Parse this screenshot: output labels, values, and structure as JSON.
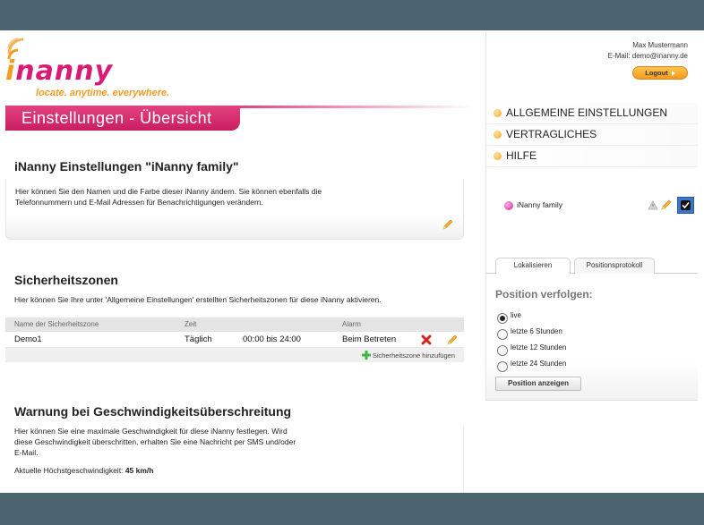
{
  "brand": {
    "name": "nanny",
    "initial": "i",
    "tagline": "locate. anytime. everywhere."
  },
  "header": {
    "title": "Einstellungen - Übersicht"
  },
  "settings": {
    "title": "iNanny Einstellungen \"iNanny family\"",
    "desc_line1": "Hier können Sie den Namen und die Farbe dieser iNanny ändern. Sie können ebenfalls die",
    "desc_line2": "Telefonnummern und E-Mail Adressen für Benachrichtigungen verändern."
  },
  "zones": {
    "title": "Sicherheitszonen",
    "desc": "Hier können Sie Ihre unter 'Allgemeine Einstellungen' erstellten Sicherheitszonen für diese iNanny aktivieren.",
    "columns": [
      "Name der Sicherheitszone",
      "Zeit",
      "Alarm"
    ],
    "rows": [
      {
        "name": "Demo1",
        "day": "Täglich",
        "time": "00:00 bis 24:00",
        "alarm": "Beim Betreten"
      }
    ],
    "add_label": "Sicherheitszone hinzufügen"
  },
  "speed": {
    "title": "Warnung bei Geschwindigkeitsüberschreitung",
    "desc_line1": "Hier können Sie eine maximale Geschwindigkeit für diese iNanny festlegen. Wird",
    "desc_line2": "diese Geschwindigkeit überschritten, erhalten Sie eine Nachricht per SMS und/oder",
    "desc_line3": "E-Mail.",
    "current_label": "Aktuelle Höchstgeschwindigkeit:",
    "current_value": "45 km/h"
  },
  "user": {
    "name": "Max Mustermann",
    "email": "E-Mail: demo@inanny.de",
    "logout_label": "Logout"
  },
  "nav": {
    "items": [
      {
        "label": "ALLGEMEINE EINSTELLUNGEN"
      },
      {
        "label": "VERTRAGLICHES"
      },
      {
        "label": "HILFE"
      }
    ]
  },
  "device": {
    "name": "iNanny family",
    "checked": true
  },
  "tabs": [
    {
      "label": "Lokalisieren",
      "active": true
    },
    {
      "label": "Positionsprotokoll",
      "active": false
    }
  ],
  "position": {
    "title": "Position verfolgen:",
    "options": [
      {
        "label": "live",
        "selected": true
      },
      {
        "label": "letzte 6 Stunden",
        "selected": false
      },
      {
        "label": "letzte 12 Stunden",
        "selected": false
      },
      {
        "label": "letzte 24 Stunden",
        "selected": false
      }
    ],
    "button_label": "Position anzeigen"
  },
  "colors": {
    "brand_pink": "#d81b74",
    "brand_orange": "#f39c21",
    "frame": "#4b6570",
    "checkbox_blue": "#3d77c9"
  }
}
